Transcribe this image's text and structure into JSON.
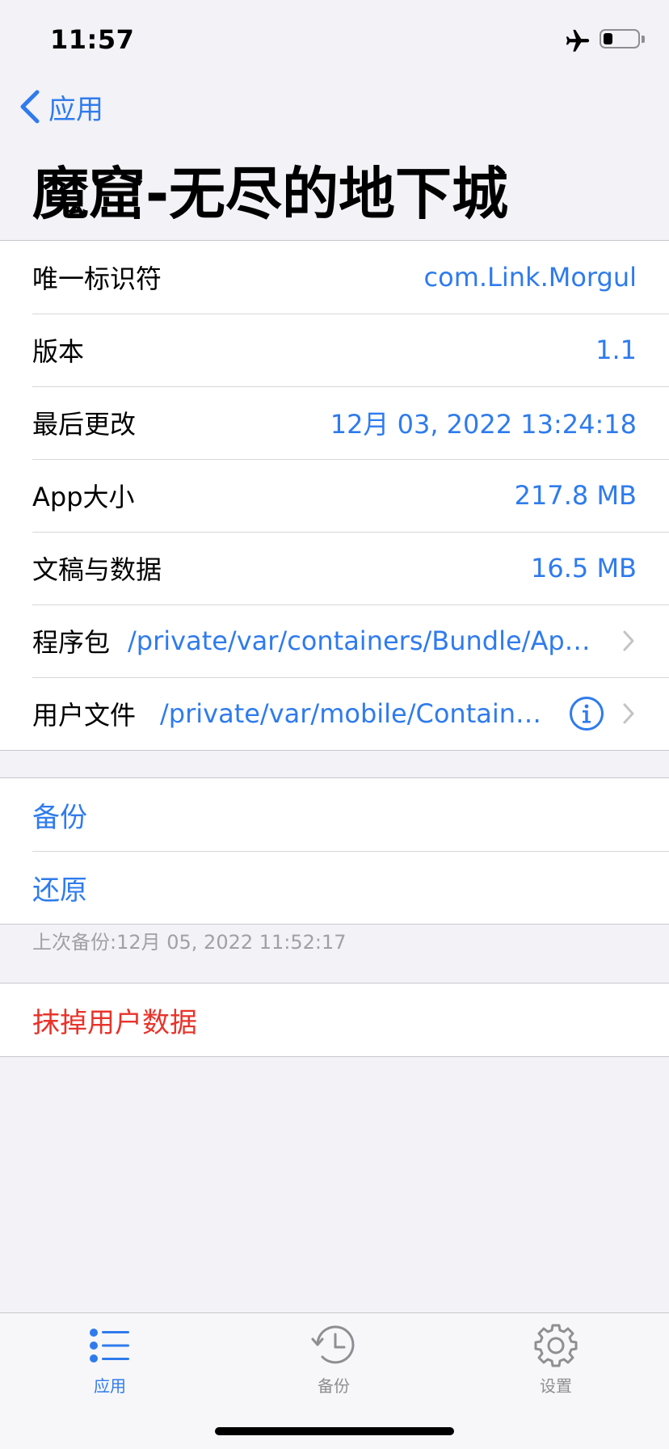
{
  "status": {
    "time": "11:57"
  },
  "nav": {
    "back_label": "应用"
  },
  "title": "魔窟-无尽的地下城",
  "info_rows": [
    {
      "label": "唯一标识符",
      "value": "com.Link.Morgul"
    },
    {
      "label": "版本",
      "value": "1.1"
    },
    {
      "label": "最后更改",
      "value": "12月 03, 2022 13:24:18"
    },
    {
      "label": "App大小",
      "value": "217.8 MB"
    },
    {
      "label": "文稿与数据",
      "value": "16.5 MB"
    }
  ],
  "path_rows": [
    {
      "label": "程序包",
      "value": "/private/var/containers/Bundle/Applic..."
    },
    {
      "label": "用户文件",
      "value": "/private/var/mobile/Containers..."
    }
  ],
  "actions": {
    "backup": "备份",
    "restore": "还原"
  },
  "last_backup_note": "上次备份:12月 05, 2022 11:52:17",
  "danger_action": "抹掉用户数据",
  "tabs": [
    {
      "label": "应用",
      "icon": "list-icon",
      "active": true
    },
    {
      "label": "备份",
      "icon": "history-clock-icon",
      "active": false
    },
    {
      "label": "设置",
      "icon": "gear-icon",
      "active": false
    }
  ],
  "colors": {
    "accent": "#2f7bed",
    "danger": "#e8332a",
    "background": "#f2f2f7"
  }
}
